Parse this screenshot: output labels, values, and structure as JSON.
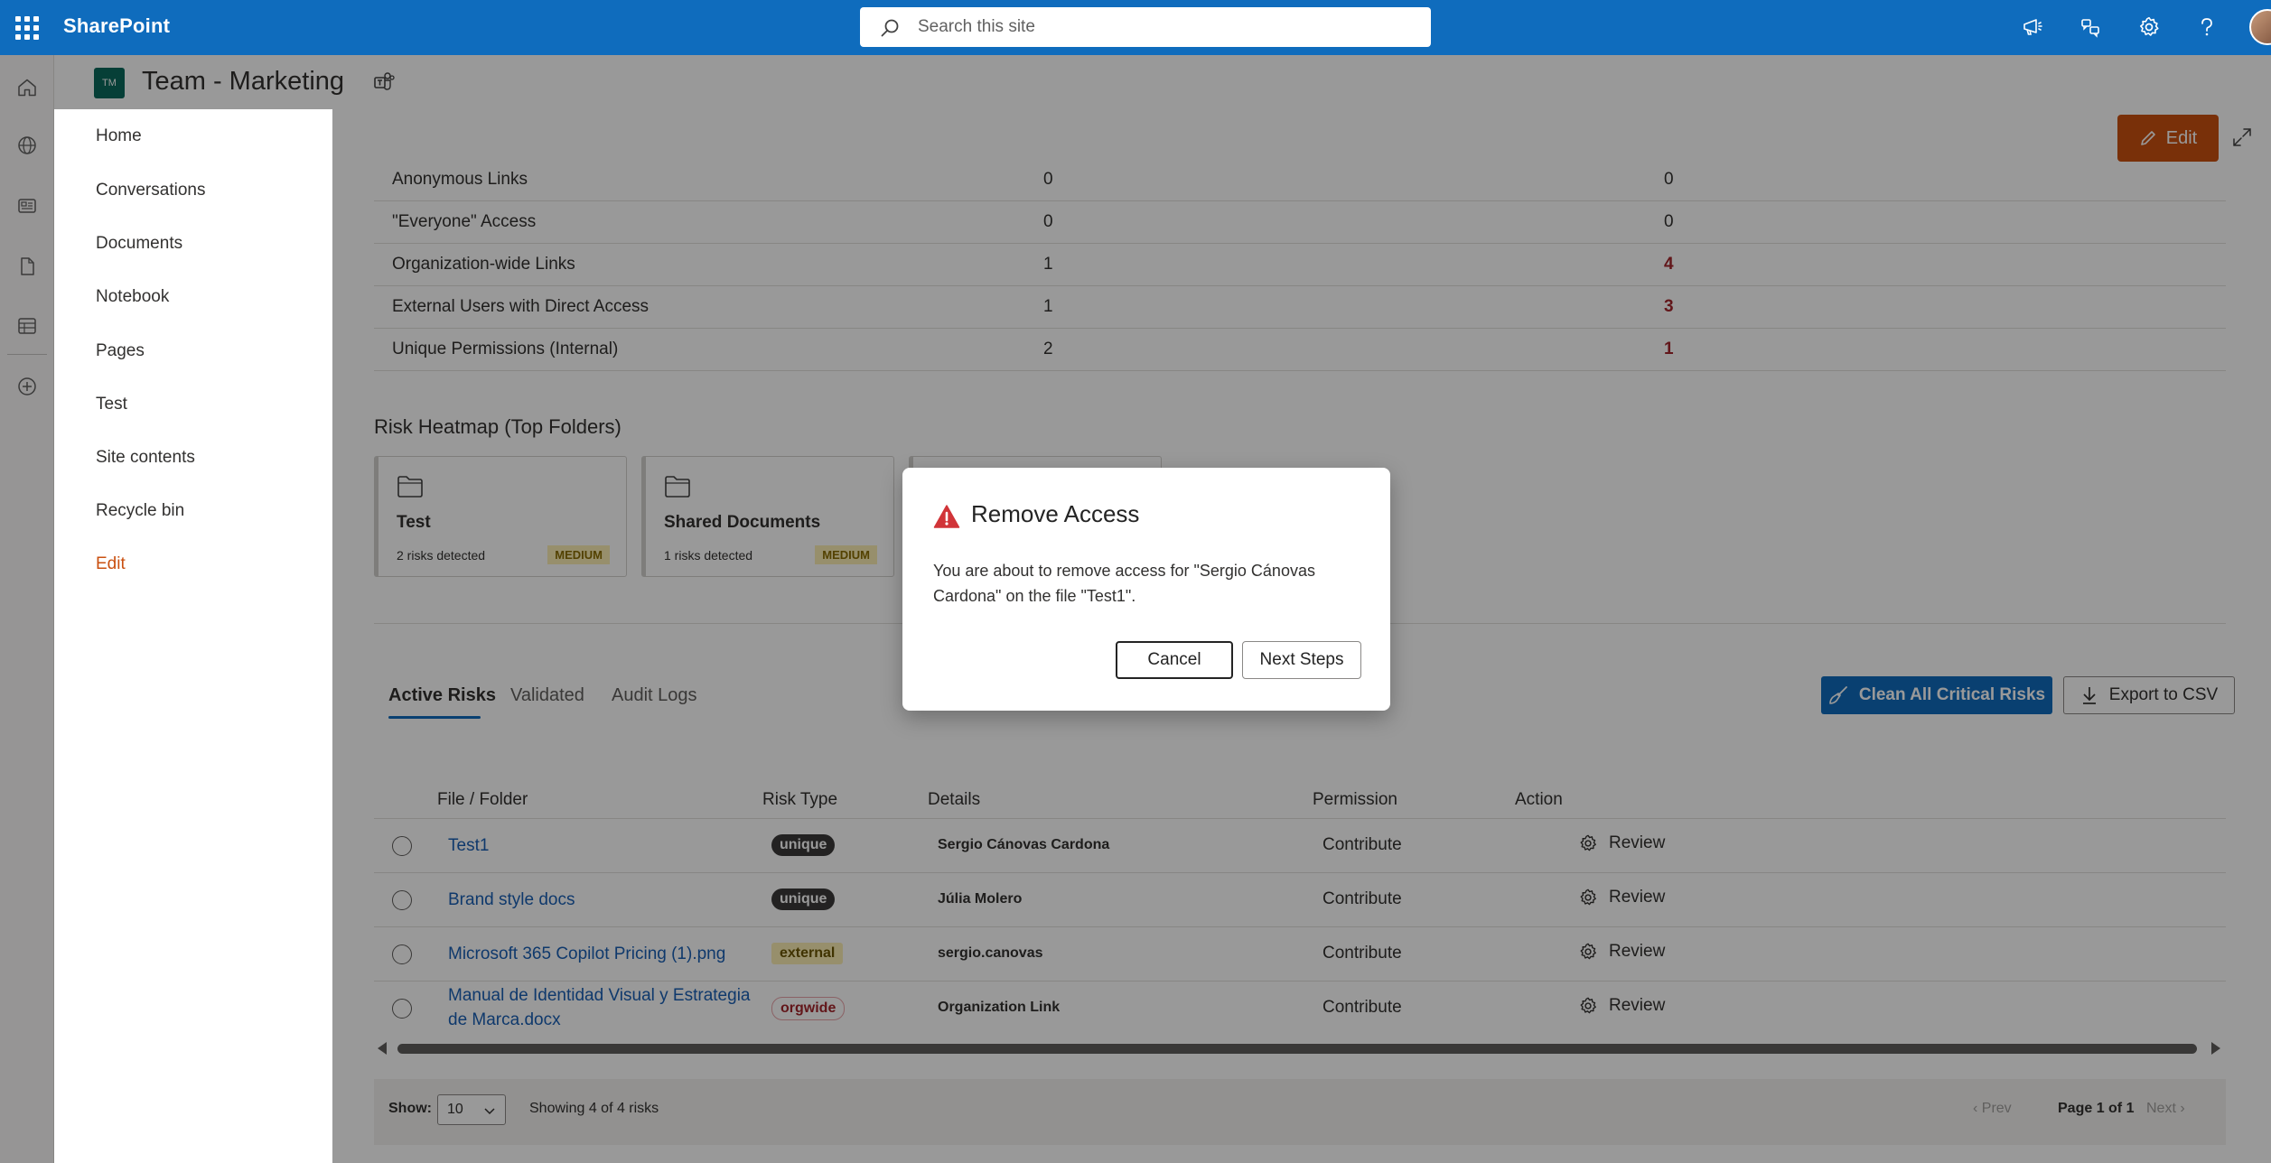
{
  "suite": {
    "brand": "SharePoint",
    "search_placeholder": "Search this site"
  },
  "site": {
    "logo_initials": "TM",
    "title": "Team - Marketing",
    "edit_label": "Edit"
  },
  "nav": {
    "items": [
      {
        "label": "Home"
      },
      {
        "label": "Conversations"
      },
      {
        "label": "Documents"
      },
      {
        "label": "Notebook"
      },
      {
        "label": "Pages"
      },
      {
        "label": "Test"
      },
      {
        "label": "Site contents"
      },
      {
        "label": "Recycle bin"
      },
      {
        "label": "Edit"
      }
    ]
  },
  "metrics": [
    {
      "label": "Anonymous Links",
      "v1": "0",
      "v2": "0"
    },
    {
      "label": "\"Everyone\" Access",
      "v1": "0",
      "v2": "0"
    },
    {
      "label": "Organization-wide Links",
      "v1": "1",
      "v2": "4"
    },
    {
      "label": "External Users with Direct Access",
      "v1": "1",
      "v2": "3"
    },
    {
      "label": "Unique Permissions (Internal)",
      "v1": "2",
      "v2": "1"
    }
  ],
  "heatmap": {
    "title": "Risk Heatmap (Top Folders)",
    "cards": [
      {
        "name": "Test",
        "count": "2 risks detected",
        "level": "MEDIUM"
      },
      {
        "name": "Shared Documents",
        "count": "1 risks detected",
        "level": "MEDIUM"
      }
    ]
  },
  "tabs": [
    {
      "label": "Active Risks"
    },
    {
      "label": "Validated"
    },
    {
      "label": "Audit Logs"
    }
  ],
  "actions": {
    "clean": "Clean All Critical Risks",
    "export": "Export to CSV"
  },
  "table": {
    "headers": [
      "File / Folder",
      "Risk Type",
      "Details",
      "Permission",
      "Action"
    ],
    "rows": [
      {
        "file": "Test1",
        "risk": "unique",
        "details": "Sergio Cánovas Cardona",
        "permission": "Contribute",
        "action": "Review"
      },
      {
        "file": "Brand style docs",
        "risk": "unique",
        "details": "Júlia Molero",
        "permission": "Contribute",
        "action": "Review"
      },
      {
        "file": "Microsoft 365 Copilot Pricing (1).png",
        "risk": "external",
        "details": "sergio.canovas",
        "permission": "Contribute",
        "action": "Review"
      },
      {
        "file": "Manual de Identidad Visual y Estrategia de Marca.docx",
        "risk": "orgwide",
        "details": "Organization Link",
        "permission": "Contribute",
        "action": "Review"
      }
    ]
  },
  "footer": {
    "show_label": "Show:",
    "page_size": "10",
    "showing": "Showing 4 of 4 risks",
    "prev": "Prev",
    "page_info": "Page 1 of 1",
    "next": "Next"
  },
  "dialog": {
    "title": "Remove Access",
    "message": "You are about to remove access for \"Sergio Cánovas Cardona\" on the file \"Test1\".",
    "cancel": "Cancel",
    "next_steps": "Next Steps"
  },
  "colors": {
    "suite_blue": "#0f6cbd",
    "edit_orange": "#ca5010",
    "risk_red": "#a4262c"
  }
}
